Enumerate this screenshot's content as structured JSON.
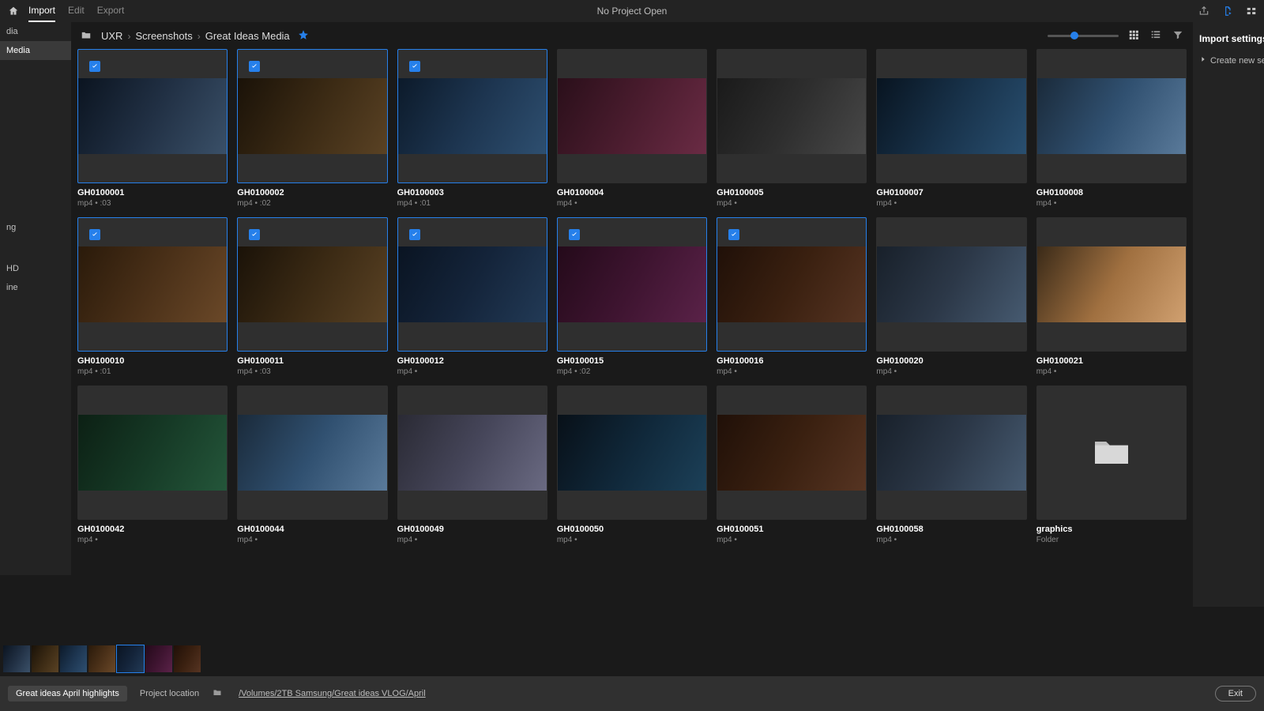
{
  "topbar": {
    "tabs": [
      "Import",
      "Edit",
      "Export"
    ],
    "active_tab_index": 0,
    "title": "No Project Open"
  },
  "breadcrumb": {
    "items": [
      "UXR",
      "Screenshots",
      "Great Ideas Media"
    ],
    "favorited": true
  },
  "sidebar": {
    "items_top": [
      "dia",
      "Media"
    ],
    "active_index": 1,
    "items_mid": [
      "ng"
    ],
    "items_low": [
      "HD",
      "ine"
    ]
  },
  "right_panel": {
    "title": "Import settings",
    "rows": [
      {
        "label": "Create new sequ"
      }
    ]
  },
  "zoom": {
    "position_pct": 32
  },
  "clips": [
    {
      "name": "GH0100001",
      "ext": "mp4",
      "duration": ":03",
      "selected": true,
      "variant": 0
    },
    {
      "name": "GH0100002",
      "ext": "mp4",
      "duration": ":02",
      "selected": true,
      "variant": 1
    },
    {
      "name": "GH0100003",
      "ext": "mp4",
      "duration": ":01",
      "selected": true,
      "variant": 2
    },
    {
      "name": "GH0100004",
      "ext": "mp4",
      "duration": "",
      "selected": false,
      "variant": 3
    },
    {
      "name": "GH0100005",
      "ext": "mp4",
      "duration": "",
      "selected": false,
      "variant": 4
    },
    {
      "name": "GH0100007",
      "ext": "mp4",
      "duration": "",
      "selected": false,
      "variant": 5
    },
    {
      "name": "GH0100008",
      "ext": "mp4",
      "duration": "",
      "selected": false,
      "variant": 6
    },
    {
      "name": "GH0100010",
      "ext": "mp4",
      "duration": ":01",
      "selected": true,
      "variant": 7
    },
    {
      "name": "GH0100011",
      "ext": "mp4",
      "duration": ":03",
      "selected": true,
      "variant": 1
    },
    {
      "name": "GH0100012",
      "ext": "mp4",
      "duration": "",
      "selected": true,
      "variant": 8
    },
    {
      "name": "GH0100015",
      "ext": "mp4",
      "duration": ":02",
      "selected": true,
      "variant": 9
    },
    {
      "name": "GH0100016",
      "ext": "mp4",
      "duration": "",
      "selected": true,
      "variant": 13
    },
    {
      "name": "GH0100020",
      "ext": "mp4",
      "duration": "",
      "selected": false,
      "variant": 12
    },
    {
      "name": "GH0100021",
      "ext": "mp4",
      "duration": "",
      "selected": false,
      "variant": 10
    },
    {
      "name": "GH0100042",
      "ext": "mp4",
      "duration": "",
      "selected": false,
      "variant": 11
    },
    {
      "name": "GH0100044",
      "ext": "mp4",
      "duration": "",
      "selected": false,
      "variant": 6
    },
    {
      "name": "GH0100049",
      "ext": "mp4",
      "duration": "",
      "selected": false,
      "variant": 15
    },
    {
      "name": "GH0100050",
      "ext": "mp4",
      "duration": "",
      "selected": false,
      "variant": 14
    },
    {
      "name": "GH0100051",
      "ext": "mp4",
      "duration": "",
      "selected": false,
      "variant": 13
    },
    {
      "name": "GH0100058",
      "ext": "mp4",
      "duration": "",
      "selected": false,
      "variant": 12
    },
    {
      "name": "graphics",
      "ext": "Folder",
      "duration": "",
      "selected": false,
      "is_folder": true
    }
  ],
  "tray": {
    "thumbs": [
      0,
      1,
      2,
      7,
      8,
      9,
      13
    ],
    "highlight_index": 4
  },
  "footer": {
    "project_name": "Great ideas April highlights",
    "location_label": "Project location",
    "location_path": "/Volumes/2TB Samsung/Great ideas VLOG/April",
    "exit_label": "Exit"
  }
}
